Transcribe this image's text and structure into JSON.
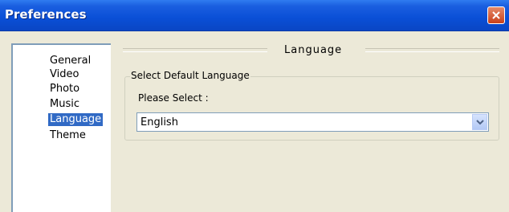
{
  "window": {
    "title": "Preferences"
  },
  "sidebar": {
    "items": [
      {
        "label": "General"
      },
      {
        "label": "Video"
      },
      {
        "label": "Photo"
      },
      {
        "label": "Music"
      },
      {
        "label": "Language",
        "selected": true
      },
      {
        "label": "Theme"
      }
    ]
  },
  "pane": {
    "heading": "Language",
    "group_title": "Select Default Language",
    "field_label": "Please Select :",
    "select": {
      "value": "English"
    }
  },
  "icons": {
    "close": "close-icon",
    "dropdown": "chevron-down-icon"
  },
  "colors": {
    "titlebar": "#0a4fd6",
    "selection": "#316ac5",
    "close_button": "#c9401a",
    "window_bg": "#ece9d8"
  }
}
